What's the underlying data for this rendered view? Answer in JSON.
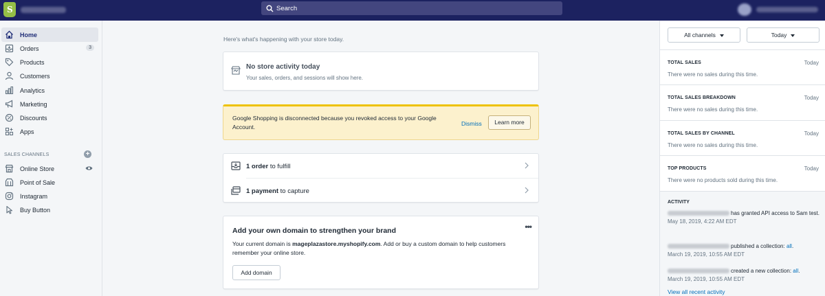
{
  "topbar": {
    "search_placeholder": "Search"
  },
  "sidebar": {
    "items": [
      {
        "label": "Home"
      },
      {
        "label": "Orders",
        "badge": "3"
      },
      {
        "label": "Products"
      },
      {
        "label": "Customers"
      },
      {
        "label": "Analytics"
      },
      {
        "label": "Marketing"
      },
      {
        "label": "Discounts"
      },
      {
        "label": "Apps"
      }
    ],
    "sales_channels_title": "SALES CHANNELS",
    "channels": [
      {
        "label": "Online Store"
      },
      {
        "label": "Point of Sale"
      },
      {
        "label": "Instagram"
      },
      {
        "label": "Buy Button"
      }
    ]
  },
  "main": {
    "greeting": "Here's what's happening with your store today.",
    "no_activity": {
      "title": "No store activity today",
      "subtitle": "Your sales, orders, and sessions will show here."
    },
    "banner": {
      "text": "Google Shopping is disconnected because you revoked access to your Google Account.",
      "dismiss": "Dismiss",
      "learn_more": "Learn more"
    },
    "tasks": [
      {
        "bold": "1 order",
        "rest": " to fulfill"
      },
      {
        "bold": "1 payment",
        "rest": " to capture"
      }
    ],
    "domain": {
      "title": "Add your own domain to strengthen your brand",
      "text_before": "Your current domain is ",
      "domain": "mageplazastore.myshopify.com",
      "text_after": ". Add or buy a custom domain to help customers remember your online store.",
      "button": "Add domain",
      "menu": "•••"
    }
  },
  "right": {
    "channels_filter": "All channels",
    "date_filter": "Today",
    "sections": [
      {
        "title": "TOTAL SALES",
        "date": "Today",
        "text": "There were no sales during this time."
      },
      {
        "title": "TOTAL SALES BREAKDOWN",
        "date": "Today",
        "text": "There were no sales during this time."
      },
      {
        "title": "TOTAL SALES BY CHANNEL",
        "date": "Today",
        "text": "There were no sales during this time."
      },
      {
        "title": "TOP PRODUCTS",
        "date": "Today",
        "text": "There were no products sold during this time."
      }
    ],
    "activity": {
      "title": "ACTIVITY",
      "items": [
        {
          "text": "has granted API access to Sam test.",
          "link": "",
          "time": "May 18, 2019, 4:22 AM EDT"
        },
        {
          "text": "published a collection: ",
          "link": "all",
          "time": "March 19, 2019, 10:55 AM EDT"
        },
        {
          "text": "created a new collection: ",
          "link": "all",
          "time": "March 19, 2019, 10:55 AM EDT"
        }
      ],
      "view_all": "View all recent activity"
    }
  },
  "colors": {
    "topbar": "#1c2260",
    "accent": "#202e78",
    "link": "#006fbb",
    "banner": "#fcf1cd",
    "logo": "#95bf47"
  }
}
